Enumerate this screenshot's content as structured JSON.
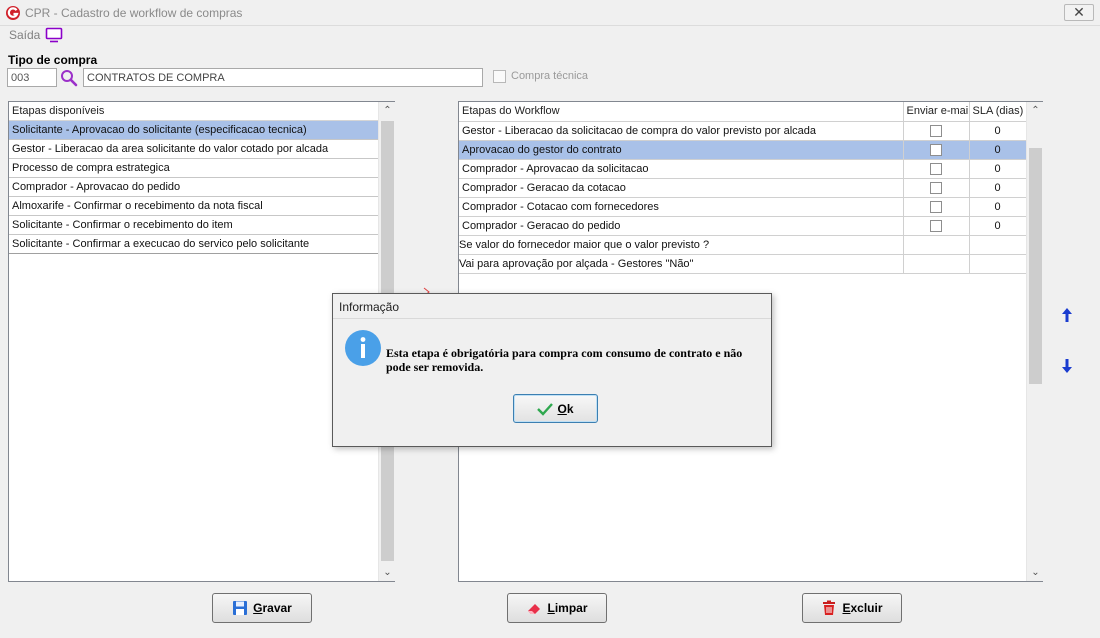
{
  "window": {
    "title": "CPR - Cadastro de workflow de compras",
    "close_label": "✕"
  },
  "menu": {
    "saida_label": "Saída"
  },
  "form": {
    "tipo_label": "Tipo de compra",
    "code_value": "003",
    "description_value": "CONTRATOS DE COMPRA",
    "compra_tecnica_label": "Compra técnica"
  },
  "left_list": {
    "header": "Etapas disponíveis",
    "items": [
      "Solicitante - Aprovacao do solicitante (especificacao tecnica)",
      "Gestor - Liberacao da area solicitante do valor cotado por alcada",
      "Processo de compra estrategica",
      "Comprador - Aprovacao do pedido",
      "Almoxarife - Confirmar o recebimento da nota fiscal",
      "Solicitante - Confirmar o recebimento do item",
      "Solicitante - Confirmar a execucao do servico pelo solicitante"
    ]
  },
  "workflow": {
    "headers": {
      "etapas": "Etapas do Workflow",
      "email": "Enviar e-mail",
      "sla": "SLA (dias)"
    },
    "rows": [
      {
        "etapa": "Gestor - Liberacao da solicitacao de compra do valor previsto por alcada",
        "sla": "0"
      },
      {
        "etapa": "Aprovacao do gestor do contrato",
        "sla": "0"
      },
      {
        "etapa": "Comprador - Aprovacao da solicitacao",
        "sla": "0"
      },
      {
        "etapa": "Comprador - Geracao da cotacao",
        "sla": "0"
      },
      {
        "etapa": "Comprador - Cotacao com fornecedores",
        "sla": "0"
      },
      {
        "etapa": "Comprador - Geracao do pedido",
        "sla": "0"
      }
    ],
    "notes": [
      "Se valor do fornecedor maior que o valor previsto ?",
      "Vai para aprovação por alçada - Gestores \"Não\""
    ]
  },
  "buttons": {
    "gravar": {
      "underline": "G",
      "rest": "ravar"
    },
    "limpar": {
      "underline": "L",
      "rest": "impar"
    },
    "excluir": {
      "underline": "E",
      "rest": "xcluir"
    }
  },
  "dialog": {
    "title": "Informação",
    "message": "Esta etapa é obrigatória para compra com consumo de contrato e não pode ser removida.",
    "ok_underline": "O",
    "ok_rest": "k"
  },
  "colors": {
    "selection": "#a9c1e8",
    "info_icon": "#4aa0e8",
    "accent_purple": "#8b00c9"
  }
}
